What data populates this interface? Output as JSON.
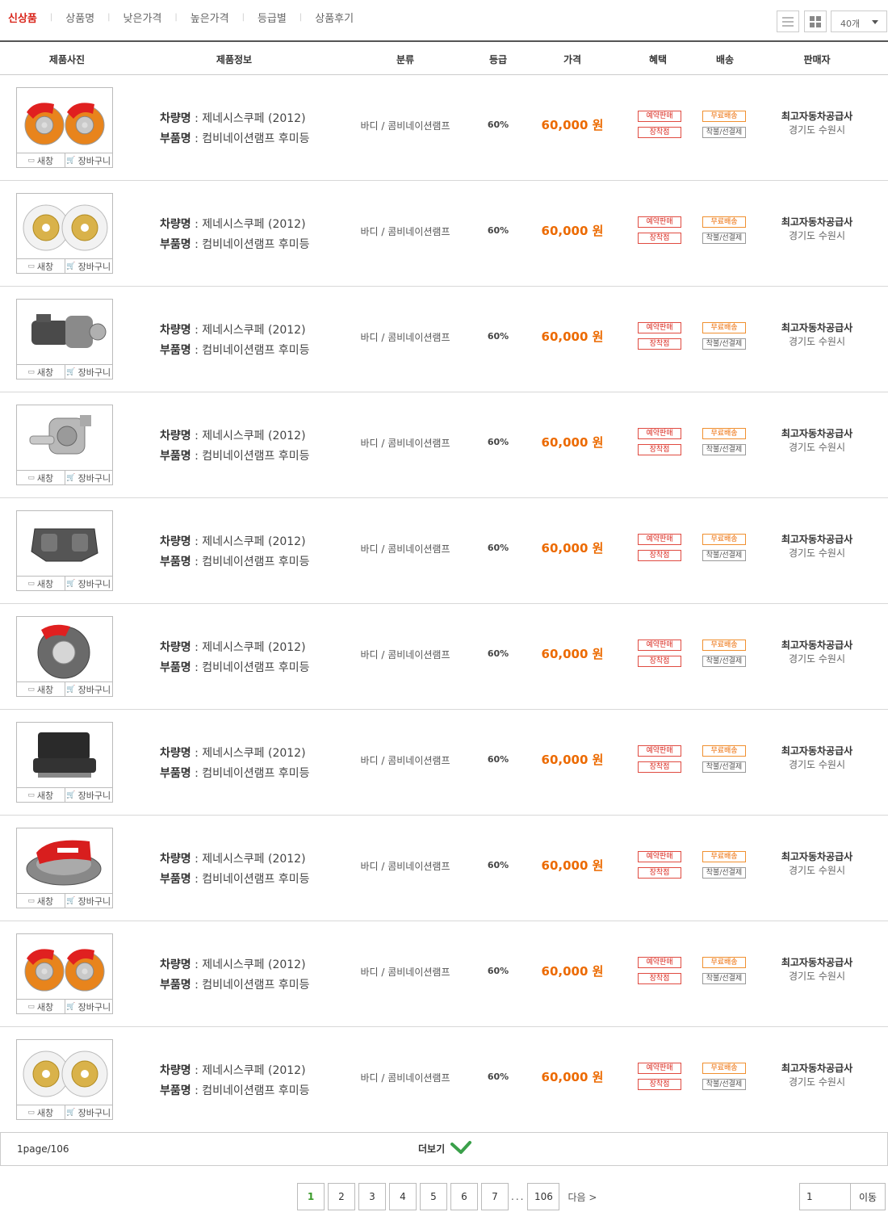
{
  "sort_tabs": [
    {
      "label": "신상품",
      "active": true
    },
    {
      "label": "상품명",
      "active": false
    },
    {
      "label": "낮은가격",
      "active": false
    },
    {
      "label": "높은가격",
      "active": false
    },
    {
      "label": "등급별",
      "active": false
    },
    {
      "label": "상품후기",
      "active": false
    }
  ],
  "view_options": {
    "list_icon": "list-view-icon",
    "grid_icon": "grid-view-icon",
    "count_value": "40개"
  },
  "table_headers": [
    "제품사진",
    "제품정보",
    "분류",
    "등급",
    "가격",
    "혜택",
    "배송",
    "판매자"
  ],
  "thumb_buttons": {
    "new_window": "새창",
    "cart": "장바구니"
  },
  "products": [
    {
      "image": "red-brake-calipers-pair",
      "car_label": "차량명",
      "car": "제네시스쿠페 (2012)",
      "part_label": "부품명",
      "part": "컴비네이션램프 후미등",
      "category": "바디 / 콤비네이션램프",
      "grade": "60%",
      "price": "60,000 원",
      "benefits": [
        "예약판매",
        "장착점"
      ],
      "shipping": [
        "무료배송",
        "착불/선결제"
      ],
      "seller_name": "최고자동차공급사",
      "seller_location": "경기도 수원시"
    },
    {
      "image": "gold-brake-discs-pair",
      "car_label": "차량명",
      "car": "제네시스쿠페 (2012)",
      "part_label": "부품명",
      "part": "컴비네이션램프 후미등",
      "category": "바디 / 콤비네이션램프",
      "grade": "60%",
      "price": "60,000 원",
      "benefits": [
        "예약판매",
        "장착점"
      ],
      "shipping": [
        "무료배송",
        "착불/선결제"
      ],
      "seller_name": "최고자동차공급사",
      "seller_location": "경기도 수원시"
    },
    {
      "image": "starter-motor",
      "car_label": "차량명",
      "car": "제네시스쿠페 (2012)",
      "part_label": "부품명",
      "part": "컴비네이션램프 후미등",
      "category": "바디 / 콤비네이션램프",
      "grade": "60%",
      "price": "60,000 원",
      "benefits": [
        "예약판매",
        "장착점"
      ],
      "shipping": [
        "무료배송",
        "착불/선결제"
      ],
      "seller_name": "최고자동차공급사",
      "seller_location": "경기도 수원시"
    },
    {
      "image": "water-pump",
      "car_label": "차량명",
      "car": "제네시스쿠페 (2012)",
      "part_label": "부품명",
      "part": "컴비네이션램프 후미등",
      "category": "바디 / 콤비네이션램프",
      "grade": "60%",
      "price": "60,000 원",
      "benefits": [
        "예약판매",
        "장착점"
      ],
      "shipping": [
        "무료배송",
        "착불/선결제"
      ],
      "seller_name": "최고자동차공급사",
      "seller_location": "경기도 수원시"
    },
    {
      "image": "brake-caliper-gray",
      "car_label": "차량명",
      "car": "제네시스쿠페 (2012)",
      "part_label": "부품명",
      "part": "컴비네이션램프 후미등",
      "category": "바디 / 콤비네이션램프",
      "grade": "60%",
      "price": "60,000 원",
      "benefits": [
        "예약판매",
        "장착점"
      ],
      "shipping": [
        "무료배송",
        "착불/선결제"
      ],
      "seller_name": "최고자동차공급사",
      "seller_location": "경기도 수원시"
    },
    {
      "image": "brake-disc-red-caliper",
      "car_label": "차량명",
      "car": "제네시스쿠페 (2012)",
      "part_label": "부품명",
      "part": "컴비네이션램프 후미등",
      "category": "바디 / 콤비네이션램프",
      "grade": "60%",
      "price": "60,000 원",
      "benefits": [
        "예약판매",
        "장착점"
      ],
      "shipping": [
        "무료배송",
        "착불/선결제"
      ],
      "seller_name": "최고자동차공급사",
      "seller_location": "경기도 수원시"
    },
    {
      "image": "car-seat",
      "car_label": "차량명",
      "car": "제네시스쿠페 (2012)",
      "part_label": "부품명",
      "part": "컴비네이션램프 후미등",
      "category": "바디 / 콤비네이션램프",
      "grade": "60%",
      "price": "60,000 원",
      "benefits": [
        "예약판매",
        "장착점"
      ],
      "shipping": [
        "무료배송",
        "착불/선결제"
      ],
      "seller_name": "최고자동차공급사",
      "seller_location": "경기도 수원시"
    },
    {
      "image": "red-brake-kit",
      "car_label": "차량명",
      "car": "제네시스쿠페 (2012)",
      "part_label": "부품명",
      "part": "컴비네이션램프 후미등",
      "category": "바디 / 콤비네이션램프",
      "grade": "60%",
      "price": "60,000 원",
      "benefits": [
        "예약판매",
        "장착점"
      ],
      "shipping": [
        "무료배송",
        "착불/선결제"
      ],
      "seller_name": "최고자동차공급사",
      "seller_location": "경기도 수원시"
    },
    {
      "image": "red-brake-calipers-pair",
      "car_label": "차량명",
      "car": "제네시스쿠페 (2012)",
      "part_label": "부품명",
      "part": "컴비네이션램프 후미등",
      "category": "바디 / 콤비네이션램프",
      "grade": "60%",
      "price": "60,000 원",
      "benefits": [
        "예약판매",
        "장착점"
      ],
      "shipping": [
        "무료배송",
        "착불/선결제"
      ],
      "seller_name": "최고자동차공급사",
      "seller_location": "경기도 수원시"
    },
    {
      "image": "gold-brake-discs-pair",
      "car_label": "차량명",
      "car": "제네시스쿠페 (2012)",
      "part_label": "부품명",
      "part": "컴비네이션램프 후미등",
      "category": "바디 / 콤비네이션램프",
      "grade": "60%",
      "price": "60,000 원",
      "benefits": [
        "예약판매",
        "장착점"
      ],
      "shipping": [
        "무료배송",
        "착불/선결제"
      ],
      "seller_name": "최고자동차공급사",
      "seller_location": "경기도 수원시"
    }
  ],
  "more": {
    "page_info": "1page/106",
    "label": "더보기",
    "icon": "chevron-down-icon",
    "icon_color": "#3aa04a"
  },
  "pagination": {
    "pages": [
      "1",
      "2",
      "3",
      "4",
      "5",
      "6",
      "7"
    ],
    "current": "1",
    "dots": "...",
    "last": "106",
    "next": "다음 >"
  },
  "goto": {
    "value": "1",
    "button": "이동"
  },
  "colors": {
    "accent_red": "#d9261c",
    "price_orange": "#ec6a00",
    "active_page_green": "#3a9a2a"
  }
}
